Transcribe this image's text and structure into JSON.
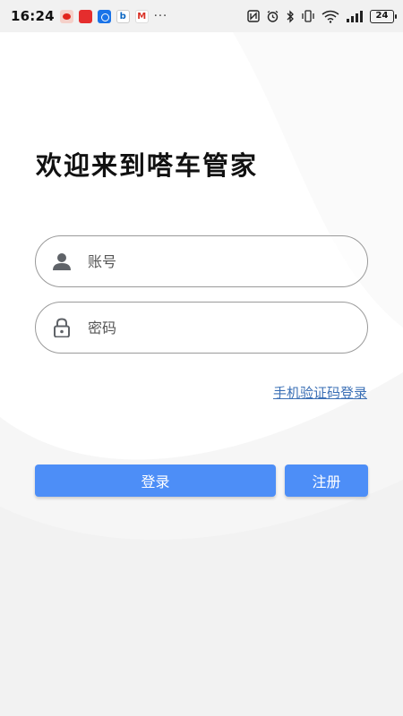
{
  "status_bar": {
    "time": "16:24",
    "more": "···",
    "battery": "24",
    "app_icons": [
      "weibo-icon",
      "red-app-icon",
      "blue-app-icon",
      "bing-icon",
      "gmail-icon"
    ],
    "system_icons": [
      "nfc-icon",
      "alarm-icon",
      "bluetooth-icon",
      "vibrate-icon",
      "wifi-icon",
      "signal-icon",
      "battery-icon"
    ]
  },
  "login": {
    "title": "欢迎来到嗒车管家",
    "username_placeholder": "账号",
    "password_placeholder": "密码",
    "sms_login_link": "手机验证码登录",
    "login_button": "登录",
    "register_button": "注册"
  },
  "colors": {
    "primary": "#4d8ef7",
    "link": "#3a6fb5",
    "border": "#9a9a9a",
    "status_bar_bg": "#f1f1f1"
  }
}
